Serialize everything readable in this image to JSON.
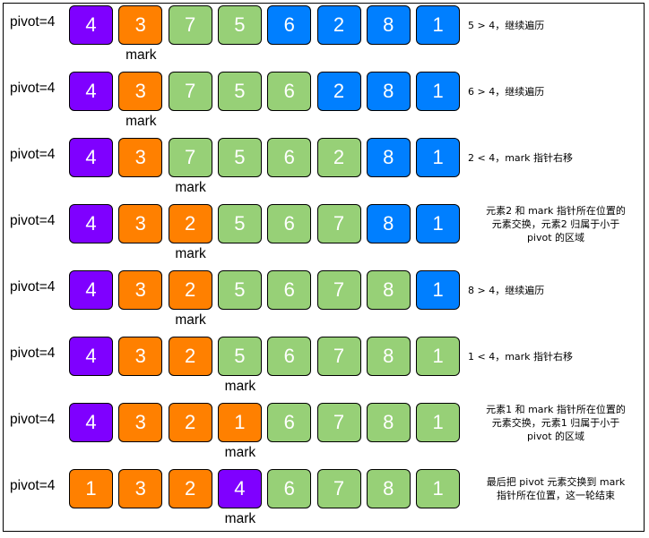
{
  "colors": {
    "purple": "#7f00ff",
    "orange": "#ff8000",
    "green": "#97d077",
    "blue": "#007fff"
  },
  "rows": [
    {
      "pivot_label": "pivot=4",
      "cells": [
        {
          "value": "4",
          "color": "purple"
        },
        {
          "value": "3",
          "color": "orange"
        },
        {
          "value": "7",
          "color": "green"
        },
        {
          "value": "5",
          "color": "green"
        },
        {
          "value": "6",
          "color": "blue"
        },
        {
          "value": "2",
          "color": "blue"
        },
        {
          "value": "8",
          "color": "blue"
        },
        {
          "value": "1",
          "color": "blue"
        }
      ],
      "mark_index": 1,
      "mark_label": "mark",
      "note_lines": [
        "5 > 4，继续遍历"
      ]
    },
    {
      "pivot_label": "pivot=4",
      "cells": [
        {
          "value": "4",
          "color": "purple"
        },
        {
          "value": "3",
          "color": "orange"
        },
        {
          "value": "7",
          "color": "green"
        },
        {
          "value": "5",
          "color": "green"
        },
        {
          "value": "6",
          "color": "green"
        },
        {
          "value": "2",
          "color": "blue"
        },
        {
          "value": "8",
          "color": "blue"
        },
        {
          "value": "1",
          "color": "blue"
        }
      ],
      "mark_index": 1,
      "mark_label": "mark",
      "note_lines": [
        "6 > 4，继续遍历"
      ]
    },
    {
      "pivot_label": "pivot=4",
      "cells": [
        {
          "value": "4",
          "color": "purple"
        },
        {
          "value": "3",
          "color": "orange"
        },
        {
          "value": "7",
          "color": "green"
        },
        {
          "value": "5",
          "color": "green"
        },
        {
          "value": "6",
          "color": "green"
        },
        {
          "value": "2",
          "color": "green"
        },
        {
          "value": "8",
          "color": "blue"
        },
        {
          "value": "1",
          "color": "blue"
        }
      ],
      "mark_index": 2,
      "mark_label": "mark",
      "note_lines": [
        "2 < 4，mark 指针右移"
      ]
    },
    {
      "pivot_label": "pivot=4",
      "cells": [
        {
          "value": "4",
          "color": "purple"
        },
        {
          "value": "3",
          "color": "orange"
        },
        {
          "value": "2",
          "color": "orange"
        },
        {
          "value": "5",
          "color": "green"
        },
        {
          "value": "6",
          "color": "green"
        },
        {
          "value": "7",
          "color": "green"
        },
        {
          "value": "8",
          "color": "blue"
        },
        {
          "value": "1",
          "color": "blue"
        }
      ],
      "mark_index": 2,
      "mark_label": "mark",
      "note_lines": [
        "元素2 和 mark 指针所在位置的",
        "元素交换，元素2 归属于小于",
        "pivot 的区域"
      ]
    },
    {
      "pivot_label": "pivot=4",
      "cells": [
        {
          "value": "4",
          "color": "purple"
        },
        {
          "value": "3",
          "color": "orange"
        },
        {
          "value": "2",
          "color": "orange"
        },
        {
          "value": "5",
          "color": "green"
        },
        {
          "value": "6",
          "color": "green"
        },
        {
          "value": "7",
          "color": "green"
        },
        {
          "value": "8",
          "color": "green"
        },
        {
          "value": "1",
          "color": "blue"
        }
      ],
      "mark_index": 2,
      "mark_label": "mark",
      "note_lines": [
        "8 > 4，继续遍历"
      ]
    },
    {
      "pivot_label": "pivot=4",
      "cells": [
        {
          "value": "4",
          "color": "purple"
        },
        {
          "value": "3",
          "color": "orange"
        },
        {
          "value": "2",
          "color": "orange"
        },
        {
          "value": "5",
          "color": "green"
        },
        {
          "value": "6",
          "color": "green"
        },
        {
          "value": "7",
          "color": "green"
        },
        {
          "value": "8",
          "color": "green"
        },
        {
          "value": "1",
          "color": "green"
        }
      ],
      "mark_index": 3,
      "mark_label": "mark",
      "note_lines": [
        "1 < 4，mark 指针右移"
      ]
    },
    {
      "pivot_label": "pivot=4",
      "cells": [
        {
          "value": "4",
          "color": "purple"
        },
        {
          "value": "3",
          "color": "orange"
        },
        {
          "value": "2",
          "color": "orange"
        },
        {
          "value": "1",
          "color": "orange"
        },
        {
          "value": "6",
          "color": "green"
        },
        {
          "value": "7",
          "color": "green"
        },
        {
          "value": "8",
          "color": "green"
        },
        {
          "value": "1",
          "color": "green"
        }
      ],
      "mark_index": 3,
      "mark_label": "mark",
      "note_lines": [
        "元素1 和 mark 指针所在位置的",
        "元素交换，元素1 归属于小于",
        "pivot 的区域"
      ]
    },
    {
      "pivot_label": "pivot=4",
      "cells": [
        {
          "value": "1",
          "color": "orange"
        },
        {
          "value": "3",
          "color": "orange"
        },
        {
          "value": "2",
          "color": "orange"
        },
        {
          "value": "4",
          "color": "purple"
        },
        {
          "value": "6",
          "color": "green"
        },
        {
          "value": "7",
          "color": "green"
        },
        {
          "value": "8",
          "color": "green"
        },
        {
          "value": "1",
          "color": "green"
        }
      ],
      "mark_index": 3,
      "mark_label": "mark",
      "note_lines": [
        "最后把 pivot 元素交换到 mark",
        "指针所在位置，这一轮结束"
      ]
    }
  ]
}
